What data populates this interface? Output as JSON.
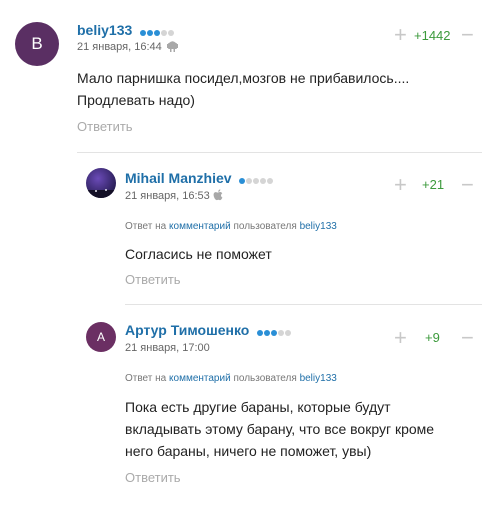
{
  "comments": [
    {
      "avatar_letter": "B",
      "avatar_color": "#5a2f63",
      "author": "beliy133",
      "time": "21 января, 16:44",
      "platform": "android-icon",
      "text_lines": [
        "Мало парнишка посидел,мозгов не прибавилось....",
        "Продлевать надо)"
      ],
      "reply_label": "Ответить",
      "rating": "+1442",
      "level_filled": 3,
      "level_total": 5
    },
    {
      "avatar_letter": "",
      "avatar_color": "#2b1f5a",
      "author": "Mihail Manzhiev",
      "time": "21 января, 16:53",
      "platform": "apple-icon",
      "reply_prefix": "Ответ на",
      "reply_link": "комментарий",
      "reply_mid": "пользователя",
      "reply_user": "beliy133",
      "text_lines": [
        "Согласись не поможет"
      ],
      "reply_label": "Ответить",
      "rating": "+21",
      "level_filled": 1,
      "level_total": 5
    },
    {
      "avatar_letter": "А",
      "avatar_color": "#6b2f63",
      "author": "Артур Тимошенко",
      "time": "21 января, 17:00",
      "reply_prefix": "Ответ на",
      "reply_link": "комментарий",
      "reply_mid": "пользователя",
      "reply_user": "beliy133",
      "text_lines": [
        "Пока есть другие бараны, которые будут",
        "вкладывать этому барану, что все вокруг кроме",
        "него бараны, ничего не поможет, увы)"
      ],
      "reply_label": "Ответить",
      "rating": "+9",
      "level_filled": 3,
      "level_total": 5
    }
  ],
  "colors": {
    "accent": "#1f6fa8",
    "rating": "#3c9a3c",
    "dot_on": "#2a8fd6",
    "dot_off": "#d5d5d5"
  }
}
